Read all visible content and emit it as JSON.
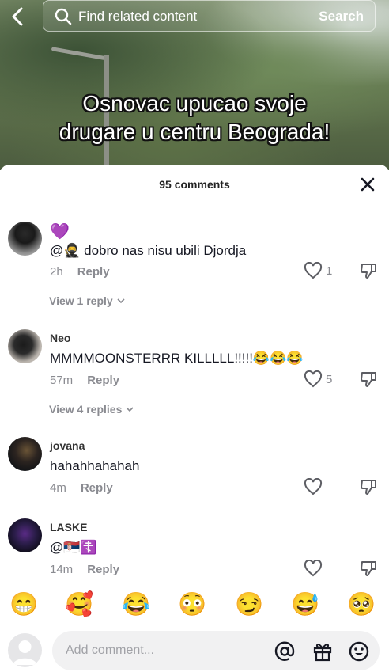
{
  "search": {
    "placeholder": "Find related content",
    "button": "Search"
  },
  "caption": {
    "line1": "Osnovac upucao svoje",
    "line2": "drugare u centru Beograda!"
  },
  "sheet": {
    "count_label": "95 comments"
  },
  "comments": [
    {
      "name": "",
      "text_prefix": "💜",
      "text": "@🥷 dobro nas nisu ubili Djordja",
      "time": "2h",
      "reply": "Reply",
      "likes": "1",
      "view_replies": "View 1 reply"
    },
    {
      "name": "Neo",
      "text": "MMMMOONSTERRR KILLLLL!!!!!😂😂😂",
      "time": "57m",
      "reply": "Reply",
      "likes": "5",
      "view_replies": "View 4 replies"
    },
    {
      "name": "jovana",
      "text": "hahahhahahah",
      "time": "4m",
      "reply": "Reply",
      "likes": ""
    },
    {
      "name": "LASKE",
      "text": "@🇷🇸☦️",
      "time": "14m",
      "reply": "Reply",
      "likes": ""
    }
  ],
  "emojis": [
    "😁",
    "🥰",
    "😂",
    "😳",
    "😏",
    "😅",
    "🥺"
  ],
  "input": {
    "placeholder": "Add comment..."
  },
  "icons": [
    "back-icon",
    "search-icon",
    "close-icon",
    "heart-icon",
    "dislike-icon",
    "chevron-down-icon",
    "at-icon",
    "gift-icon",
    "emoji-icon"
  ]
}
